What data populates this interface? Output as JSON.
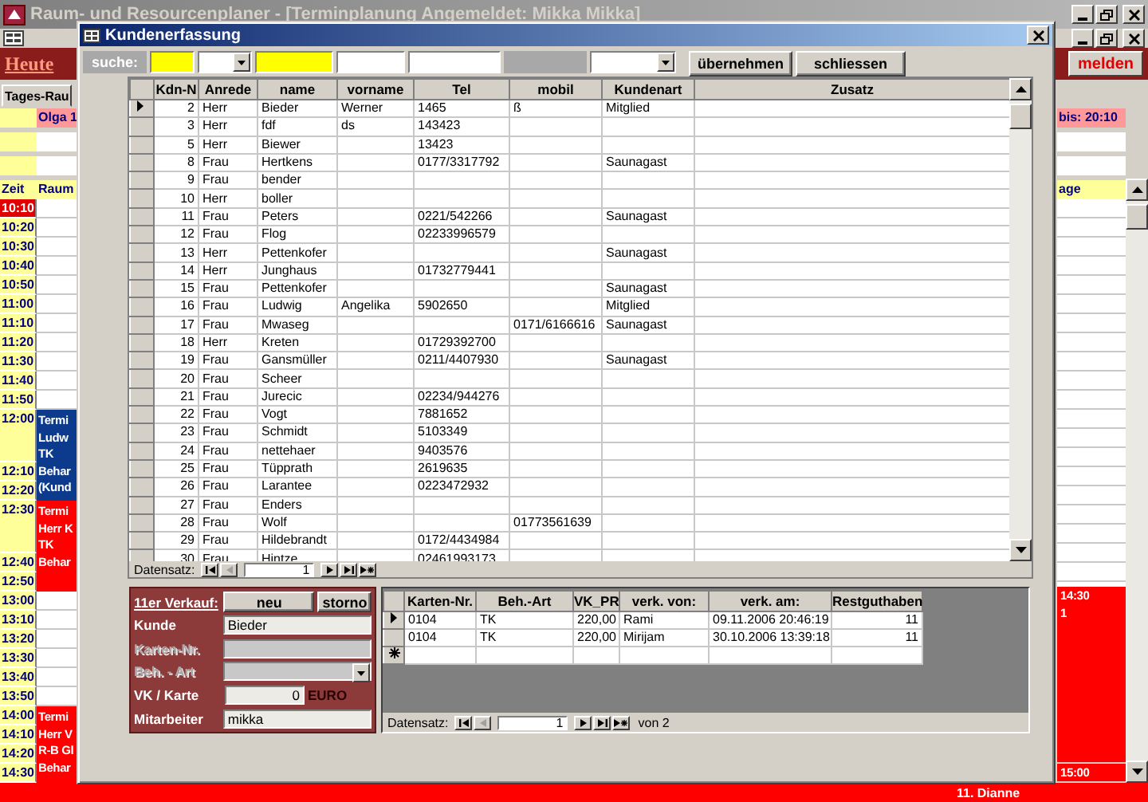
{
  "app_window": {
    "title": "Raum- und Resourcenplaner - [Terminplanung Angemeldet: Mikka Mikka]"
  },
  "toolbar": {
    "link": "Heute",
    "logout_button": "melden"
  },
  "tab": {
    "label": "Tages-Rau"
  },
  "schedule": {
    "room_header": "Olga 1",
    "time_header": "Zeit",
    "room_column_header": "Raum",
    "end_header": "bis: 20:10",
    "right_column_header": "age",
    "slots": [
      {
        "time": "10:10",
        "selected": true,
        "tall": false
      },
      {
        "time": "10:20",
        "selected": false,
        "tall": false
      },
      {
        "time": "10:30",
        "selected": false,
        "tall": false
      },
      {
        "time": "10:40",
        "selected": false,
        "tall": false
      },
      {
        "time": "10:50",
        "selected": false,
        "tall": false
      },
      {
        "time": "11:00",
        "selected": false,
        "tall": false
      },
      {
        "time": "11:10",
        "selected": false,
        "tall": false
      },
      {
        "time": "11:20",
        "selected": false,
        "tall": false
      },
      {
        "time": "11:30",
        "selected": false,
        "tall": false
      },
      {
        "time": "11:40",
        "selected": false,
        "tall": false
      },
      {
        "time": "11:50",
        "selected": false,
        "tall": false
      },
      {
        "time": "12:00",
        "selected": false,
        "tall": true,
        "color": "#0c3a8c",
        "event_lines": [
          "Termi",
          "Ludw",
          "TK",
          "Behar",
          "(Kund"
        ]
      },
      {
        "time": "12:10",
        "selected": false,
        "tall": false,
        "color": "#0c3a8c"
      },
      {
        "time": "12:20",
        "selected": false,
        "tall": false,
        "color": "#0c3a8c"
      },
      {
        "time": "12:30",
        "selected": false,
        "tall": true,
        "color": "#ff0000",
        "event_lines": [
          "Termi",
          "Herr K",
          "TK",
          "Behar"
        ]
      },
      {
        "time": "12:40",
        "selected": false,
        "tall": false,
        "color": "#ff0000"
      },
      {
        "time": "12:50",
        "selected": false,
        "tall": false,
        "color": "#ff0000"
      },
      {
        "time": "13:00",
        "selected": false,
        "tall": false
      },
      {
        "time": "13:10",
        "selected": false,
        "tall": false
      },
      {
        "time": "13:20",
        "selected": false,
        "tall": false
      },
      {
        "time": "13:30",
        "selected": false,
        "tall": false
      },
      {
        "time": "13:40",
        "selected": false,
        "tall": false
      },
      {
        "time": "13:50",
        "selected": false,
        "tall": false
      },
      {
        "time": "14:00",
        "selected": false,
        "tall": false,
        "color": "#ff0000",
        "event_lines": [
          "Termi",
          "Herr V",
          "R-B Gl",
          "Behar"
        ]
      },
      {
        "time": "14:10",
        "selected": false,
        "tall": false,
        "color": "#ff0000"
      },
      {
        "time": "14:20",
        "selected": false,
        "tall": false,
        "color": "#ff0000"
      },
      {
        "time": "14:30",
        "selected": false,
        "tall": false,
        "color": "#ff0000"
      }
    ],
    "right_events": [
      {
        "lines": [
          "14:30",
          "1"
        ],
        "color": "#ff0000"
      },
      {
        "lines": [
          "15:00"
        ],
        "color": "#ff0000"
      }
    ],
    "footer_event": "11. Dianne"
  },
  "dialog": {
    "title": "Kundenerfassung",
    "search": {
      "label": "suche:",
      "fields": [
        {
          "kind": "text",
          "color": "#ffff00"
        },
        {
          "kind": "combo",
          "color": "#ffffff"
        },
        {
          "kind": "text",
          "color": "#ffff00"
        },
        {
          "kind": "text",
          "color": "#ffffff"
        },
        {
          "kind": "text",
          "color": "#ffffff"
        },
        {
          "kind": "text",
          "color": "#a8a8a8"
        },
        {
          "kind": "combo",
          "color": "#ffffff"
        }
      ],
      "buttons": [
        "übernehmen",
        "schliessen"
      ]
    },
    "customers": {
      "columns": [
        "Kdn-N",
        "Anrede",
        "name",
        "vorname",
        "Tel",
        "mobil",
        "Kundenart",
        "Zusatz"
      ],
      "rows": [
        {
          "selected": true,
          "kdn_nr": "2",
          "anrede": "Herr",
          "name": "Bieder",
          "vorname": "Werner",
          "tel": "1465",
          "mobil": "ß",
          "kundenart": "Mitglied"
        },
        {
          "selected": false,
          "kdn_nr": "3",
          "anrede": "Herr",
          "name": "fdf",
          "vorname": "ds",
          "tel": "143423"
        },
        {
          "selected": false,
          "kdn_nr": "5",
          "anrede": "Herr",
          "name": "Biewer",
          "tel": "13423"
        },
        {
          "selected": false,
          "kdn_nr": "8",
          "anrede": "Frau",
          "name": "Hertkens",
          "tel": "0177/3317792",
          "kundenart": "Saunagast"
        },
        {
          "selected": false,
          "kdn_nr": "9",
          "anrede": "Frau",
          "name": "bender"
        },
        {
          "selected": false,
          "kdn_nr": "10",
          "anrede": "Herr",
          "name": "boller"
        },
        {
          "selected": false,
          "kdn_nr": "11",
          "anrede": "Frau",
          "name": "Peters",
          "tel": "0221/542266",
          "kundenart": "Saunagast"
        },
        {
          "selected": false,
          "kdn_nr": "12",
          "anrede": "Frau",
          "name": "Flog",
          "tel": "02233996579"
        },
        {
          "selected": false,
          "kdn_nr": "13",
          "anrede": "Herr",
          "name": "Pettenkofer",
          "kundenart": "Saunagast"
        },
        {
          "selected": false,
          "kdn_nr": "14",
          "anrede": "Herr",
          "name": "Junghaus",
          "tel": "01732779441"
        },
        {
          "selected": false,
          "kdn_nr": "15",
          "anrede": "Frau",
          "name": "Pettenkofer",
          "kundenart": "Saunagast"
        },
        {
          "selected": false,
          "kdn_nr": "16",
          "anrede": "Frau",
          "name": "Ludwig",
          "vorname": "Angelika",
          "tel": "5902650",
          "kundenart": "Mitglied"
        },
        {
          "selected": false,
          "kdn_nr": "17",
          "anrede": "Frau",
          "name": "Mwaseg",
          "mobil": "0171/6166616",
          "kundenart": "Saunagast"
        },
        {
          "selected": false,
          "kdn_nr": "18",
          "anrede": "Herr",
          "name": "Kreten",
          "tel": "01729392700"
        },
        {
          "selected": false,
          "kdn_nr": "19",
          "anrede": "Frau",
          "name": "Gansmüller",
          "tel": "0211/4407930",
          "kundenart": "Saunagast"
        },
        {
          "selected": false,
          "kdn_nr": "20",
          "anrede": "Frau",
          "name": "Scheer"
        },
        {
          "selected": false,
          "kdn_nr": "21",
          "anrede": "Frau",
          "name": "Jurecic",
          "tel": "02234/944276"
        },
        {
          "selected": false,
          "kdn_nr": "22",
          "anrede": "Frau",
          "name": "Vogt",
          "tel": "7881652"
        },
        {
          "selected": false,
          "kdn_nr": "23",
          "anrede": "Frau",
          "name": "Schmidt",
          "tel": "5103349"
        },
        {
          "selected": false,
          "kdn_nr": "24",
          "anrede": "Frau",
          "name": "nettehaer",
          "tel": "9403576"
        },
        {
          "selected": false,
          "kdn_nr": "25",
          "anrede": "Frau",
          "name": "Tüpprath",
          "tel": "2619635"
        },
        {
          "selected": false,
          "kdn_nr": "26",
          "anrede": "Frau",
          "name": "Larantee",
          "tel": "0223472932"
        },
        {
          "selected": false,
          "kdn_nr": "27",
          "anrede": "Frau",
          "name": "Enders"
        },
        {
          "selected": false,
          "kdn_nr": "28",
          "anrede": "Frau",
          "name": "Wolf",
          "mobil": "01773561639"
        },
        {
          "selected": false,
          "kdn_nr": "29",
          "anrede": "Frau",
          "name": "Hildebrandt",
          "tel": "0172/4434984"
        },
        {
          "selected": false,
          "kdn_nr": "30",
          "anrede": "Frau",
          "name": "Hintze",
          "tel": "02461993173"
        }
      ],
      "navigator": {
        "label": "Datensatz:",
        "record": "1"
      }
    },
    "sales": {
      "heading": "11er Verkauf:",
      "buttons": [
        "neu",
        "storno"
      ],
      "fields": [
        {
          "label": "Kunde",
          "kind": "text",
          "value": "Bieder",
          "disabled": false
        },
        {
          "label": "Karten-Nr.",
          "kind": "text",
          "disabled": true
        },
        {
          "label": "Beh. - Art",
          "kind": "combo",
          "disabled": true
        },
        {
          "label": "VK / Karte",
          "kind": "number",
          "value": "0",
          "unit": "EURO",
          "disabled": false
        },
        {
          "label": "Mitarbeiter",
          "kind": "text",
          "value": "mikka",
          "disabled": false
        }
      ]
    },
    "cards": {
      "columns": [
        "Karten-Nr.",
        "Beh.-Art",
        "VK_PR",
        "verk. von:",
        "verk. am:",
        "Restguthaben"
      ],
      "rows": [
        {
          "selected": true,
          "cells": [
            "0104",
            "TK",
            "220,00",
            "Rami",
            "09.11.2006 20:46:19",
            "11"
          ]
        },
        {
          "selected": false,
          "cells": [
            "0104",
            "TK",
            "220,00",
            "Mirijam",
            "30.10.2006 13:39:18",
            "11"
          ]
        }
      ],
      "navigator": {
        "label": "Datensatz:",
        "record": "1",
        "total": "von 2"
      }
    }
  }
}
